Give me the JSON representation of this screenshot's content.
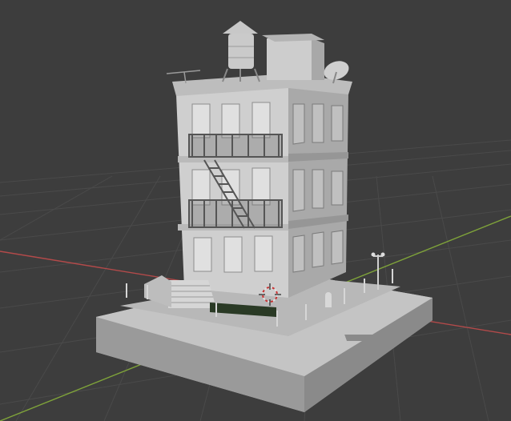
{
  "viewport": {
    "background": "#3d3d3d",
    "grid_color": "#4a4a4a",
    "x_axis_color": "#b34a4a",
    "y_axis_color": "#7fa33a",
    "cursor_colors": [
      "#e0e0e0",
      "#c83232"
    ]
  },
  "scene": {
    "model_color": "#c8c8c8",
    "shadow_color": "#8c8c8c",
    "hedge_color": "#2a3a25",
    "objects": [
      "building",
      "water-tower",
      "roof-hut",
      "satellite-dish",
      "antenna",
      "fire-escape",
      "entrance-stairs",
      "hedge",
      "street-lamp",
      "fire-hydrant",
      "bollards",
      "sidewalk-base",
      "storm-drain"
    ]
  },
  "cursor": {
    "icon": "3d-cursor-icon"
  }
}
